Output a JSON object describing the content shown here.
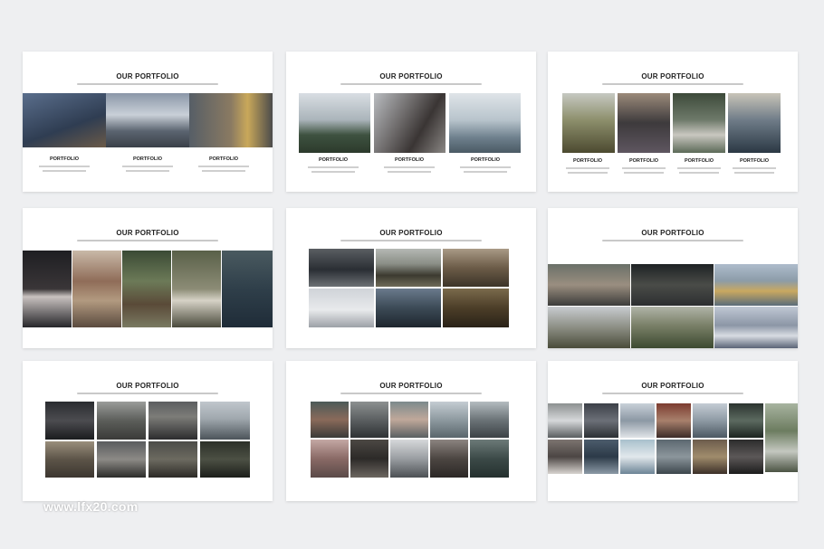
{
  "slide_title": "OUR PORTFOLIO",
  "caption": "PORTFOLIO",
  "watermark": "www.lfx20.com",
  "colors": {
    "background": "#eeeff1",
    "slide": "#ffffff",
    "title": "#222222"
  }
}
